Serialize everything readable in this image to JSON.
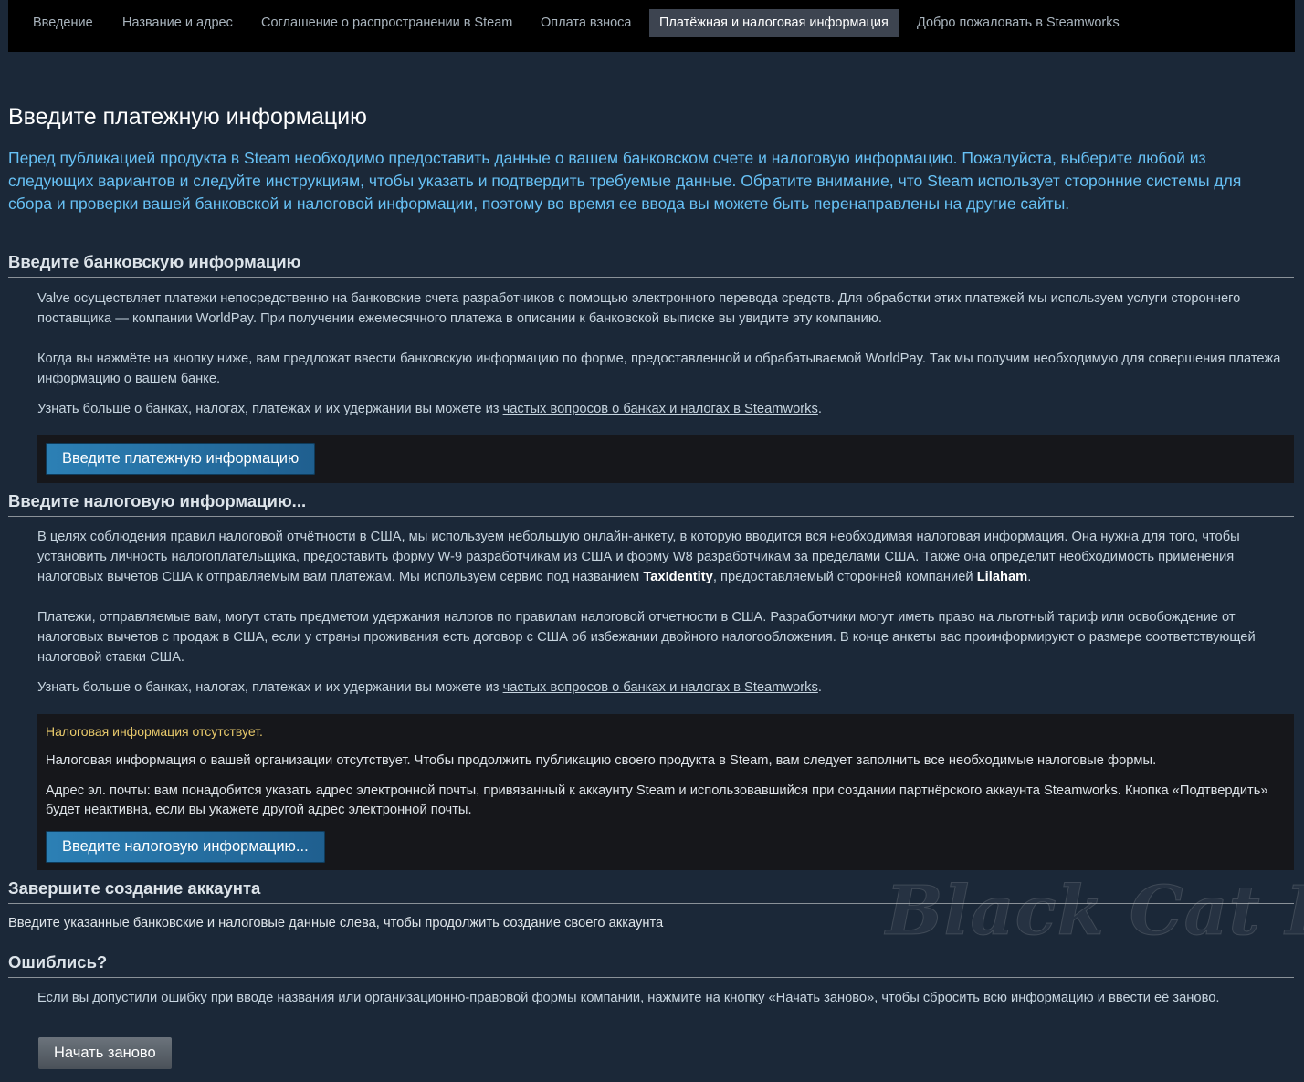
{
  "nav": {
    "tabs": [
      {
        "label": "Введение"
      },
      {
        "label": "Название и адрес"
      },
      {
        "label": "Соглашение о распространении в Steam"
      },
      {
        "label": "Оплата взноса"
      },
      {
        "label": "Платёжная и налоговая информация",
        "active": true
      },
      {
        "label": "Добро пожаловать в Steamworks"
      }
    ]
  },
  "page": {
    "title": "Введите платежную информацию",
    "intro": "Перед публикацией продукта в Steam необходимо предоставить данные о вашем банковском счете и налоговую информацию. Пожалуйста, выберите любой из следующих вариантов и следуйте инструкциям, чтобы указать и подтвердить требуемые данные. Обратите внимание, что Steam использует сторонние системы для сбора и проверки вашей банковской и налоговой информации, поэтому во время ее ввода вы можете быть перенаправлены на другие сайты."
  },
  "bank": {
    "title": "Введите банковскую информацию",
    "p1": "Valve осуществляет платежи непосредственно на банковские счета разработчиков с помощью электронного перевода средств. Для обработки этих платежей мы используем услуги стороннего поставщика — компании WorldPay. При получении ежемесячного платежа в описании к банковской выписке вы увидите эту компанию.",
    "p2": "Когда вы нажмёте на кнопку ниже, вам предложат ввести банковскую информацию по форме, предоставленной и обрабатываемой WorldPay. Так мы получим необходимую для совершения платежа информацию о вашем банке.",
    "faq_prefix": "Узнать больше о банках, налогах, платежах и их удержании вы можете из ",
    "faq_link": "частых вопросов о банках и налогах в Steamworks",
    "faq_suffix": ".",
    "button": "Введите платежную информацию"
  },
  "tax": {
    "title": "Введите налоговую информацию...",
    "p1_a": "В целях соблюдения правил налоговой отчётности в США, мы используем небольшую онлайн-анкету, в которую вводится вся необходимая налоговая информация. Она нужна для того, чтобы установить личность налогоплательщика, предоставить форму W-9 разработчикам из США и форму W8 разработчикам за пределами США. Также она определит необходимость применения налоговых вычетов США к отправляемым вам платежам. Мы используем сервис под названием ",
    "p1_b1": "TaxIdentity",
    "p1_c": ", предоставляемый сторонней компанией ",
    "p1_b2": "Lilaham",
    "p1_d": ".",
    "p2": "Платежи, отправляемые вам, могут стать предметом удержания налогов по правилам налоговой отчетности в США. Разработчики могут иметь право на льготный тариф или освобождение от налоговых вычетов с продаж в США, если у страны проживания есть договор с США об избежании двойного налогообложения. В конце анкеты вас проинформируют о размере соответствующей налоговой ставки США.",
    "faq_prefix": "Узнать больше о банках, налогах, платежах и их удержании вы можете из ",
    "faq_link": "частых вопросов о банках и налогах в Steamworks",
    "faq_suffix": ".",
    "warning": "Налоговая информация отсутствует.",
    "missing": "Налоговая информация о вашей организации отсутствует. Чтобы продолжить публикацию своего продукта в Steam, вам следует заполнить все необходимые налоговые формы.",
    "email_note": "Адрес эл. почты: вам понадобится указать адрес электронной почты, привязанный к аккаунту Steam и использовавшийся при создании партнёрского аккаунта Steamworks. Кнопка «Подтвердить» будет неактивна, если вы укажете другой адрес электронной почты.",
    "button": "Введите налоговую информацию..."
  },
  "finish": {
    "title": "Завершите создание аккаунта",
    "text": "Введите указанные банковские и налоговые данные слева, чтобы продолжить создание своего аккаунта"
  },
  "mistake": {
    "title": "Ошиблись?",
    "text": "Если вы допустили ошибку при вводе названия или организационно-правовой формы компании, нажмите на кнопку «Начать заново», чтобы сбросить всю информацию и ввести её заново.",
    "button": "Начать заново"
  },
  "watermark": {
    "text": "Black Cat Leo"
  }
}
